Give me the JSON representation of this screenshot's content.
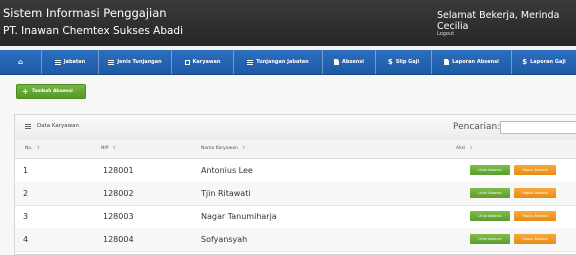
{
  "header": {
    "system_title": "Sistem Informasi Penggajian",
    "company": "PT. Inawan Chemtex Sukses Abadi",
    "welcome": "Selamat Bekerja, Merinda Cecilia",
    "logout": "Logout"
  },
  "nav": {
    "items": [
      {
        "icon": "home-icon",
        "label": ""
      },
      {
        "icon": "list-icon",
        "label": "Jabatan"
      },
      {
        "icon": "list-icon",
        "label": "Jenis Tunjangan"
      },
      {
        "icon": "list-icon",
        "label": "Karyawan"
      },
      {
        "icon": "list-icon",
        "label": "Tunjangan Jabatan"
      },
      {
        "icon": "document-icon",
        "label": "Absensi"
      },
      {
        "icon": "money-icon",
        "label": "Slip Gaji"
      },
      {
        "icon": "document-icon",
        "label": "Laporan Absensi"
      },
      {
        "icon": "money-icon",
        "label": "Laporan Gaji"
      }
    ]
  },
  "main": {
    "add_button": "Tambah Absensi",
    "panel_title": "Data Karyawan",
    "search_label": "Pencarian:",
    "search_value": "",
    "columns": [
      "No.",
      "NIP",
      "Nama Karyawan",
      "Aksi"
    ],
    "rows": [
      {
        "no": "1",
        "nip": "128001",
        "name": "Antonius Lee"
      },
      {
        "no": "2",
        "nip": "128002",
        "name": "Tjin Ritawati"
      },
      {
        "no": "3",
        "nip": "128003",
        "name": "Nagar Tanumiharja"
      },
      {
        "no": "4",
        "nip": "128004",
        "name": "Sofyansyah"
      }
    ],
    "view_label": "Lihat Absensi",
    "delete_label": "Hapus Absensi"
  },
  "colors": {
    "header_bg": "#2b2b2b",
    "nav_bg": "#2466b3",
    "add_button": "#63a534",
    "view_button": "#6aae3c",
    "delete_button": "#f09a24"
  }
}
